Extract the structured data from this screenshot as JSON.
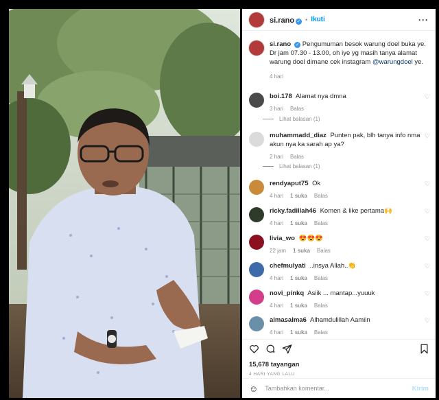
{
  "post": {
    "username": "si.rano",
    "verified_mark": "✓",
    "separator": "•",
    "follow_label": "Ikuti",
    "more_label": "···",
    "caption_text": "Pengumuman besok warung doel buka ye. Dr jam 07.30 - 13.00, oh iye yg masih tanya alamat warung doel dimane cek instagram",
    "caption_mention": "@warungdoel",
    "caption_tail": " ye.",
    "caption_time": "4 hari"
  },
  "comments": [
    {
      "username": "boi.178",
      "text": "Alamat nya dmna",
      "time": "3 hari",
      "likes": "",
      "reply": "Balas",
      "view_replies": "Lihat balasan (1)",
      "avatar_color": "#4a4a4a"
    },
    {
      "username": "muhammadd_diaz",
      "text": "Punten pak, blh tanya info nma akun nya ka sarah ap ya?",
      "time": "2 hari",
      "likes": "",
      "reply": "Balas",
      "view_replies": "Lihat balasan (1)",
      "avatar_color": "#dbdbdb"
    },
    {
      "username": "rendyaput75",
      "text": "Ok",
      "time": "4 hari",
      "likes": "1 suka",
      "reply": "Balas",
      "avatar_color": "#c98b3a"
    },
    {
      "username": "ricky.fadillah46",
      "text": "Komen & like pertama🙌",
      "time": "4 hari",
      "likes": "1 suka",
      "reply": "Balas",
      "avatar_color": "#2f3b2a"
    },
    {
      "username": "livia_wo",
      "text": "😍😍😍",
      "time": "22 jam",
      "likes": "1 suka",
      "reply": "Balas",
      "avatar_color": "#8a1020"
    },
    {
      "username": "chefmulyati",
      "text": "..insya Allah..👏",
      "time": "4 hari",
      "likes": "1 suka",
      "reply": "Balas",
      "avatar_color": "#3d6aa8"
    },
    {
      "username": "novi_pinkq",
      "text": "Asiik ... mantap...yuuuk",
      "time": "4 hari",
      "likes": "1 suka",
      "reply": "Balas",
      "avatar_color": "#d43d8a"
    },
    {
      "username": "almasalma6",
      "text": "Alhamdulillah Aamiin",
      "time": "4 hari",
      "likes": "1 suka",
      "reply": "Balas",
      "avatar_color": "#6a8fa8"
    }
  ],
  "actions": {
    "views": "15,678 tayangan",
    "posted_ago": "4 HARI YANG LALU",
    "icons": [
      "heart-icon",
      "comment-icon",
      "share-icon",
      "bookmark-icon"
    ]
  },
  "composer": {
    "placeholder": "Tambahkan komentar...",
    "post_label": "Kirim",
    "emoji_icon": "☺"
  },
  "colors": {
    "link_blue": "#0095f6",
    "verified_blue": "#3897f0",
    "muted": "#8e8e8e"
  }
}
